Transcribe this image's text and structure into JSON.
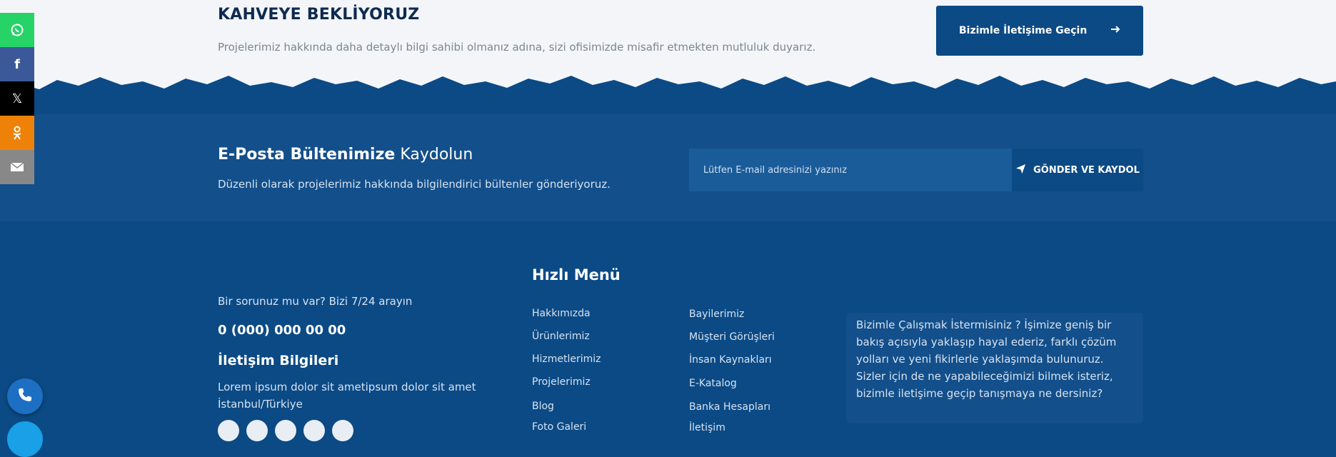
{
  "cta": {
    "title": "KAHVEYE BEKLİYORUZ",
    "description": "Projelerimiz hakkında daha detaylı bilgi sahibi olmanız adına, sizi ofisimizde misafir etmekten mutluluk duyarız.",
    "button_label": "Bizimle İletişime Geçin"
  },
  "newsletter": {
    "title_bold": "E-Posta Bültenimize",
    "title_regular": "Kaydolun",
    "description": "Düzenli olarak projelerimiz hakkında bilgilendirici bültenler gönderiyoruz.",
    "input_placeholder": "Lütfen E-mail adresinizi yazınız",
    "button_label": "GÖNDER VE KAYDOL"
  },
  "footer": {
    "help_text": "Bir sorunuz mu var? Bizi 7/24 arayın",
    "phone": "0 (000) 000 00 00",
    "contact_title": "İletişim Bilgileri",
    "address_line1": "Lorem ipsum dolor sit ametipsum dolor sit amet",
    "address_line2": "İstanbul/Türkiye",
    "quick_menu_title": "Hızlı Menü",
    "menu_col1": [
      "Hakkımızda",
      "Ürünlerimiz",
      "Hizmetlerimiz",
      "Projelerimiz",
      "Blog",
      "Foto Galeri"
    ],
    "menu_col2": [
      "Bayilerimiz",
      "Müşteri Görüşleri",
      "İnsan Kaynakları",
      "E-Katalog",
      "Banka Hesapları",
      "İletişim"
    ],
    "info_text": "Bizimle Çalışmak İstermisiniz ? İşimize geniş bir bakış açısıyla yaklaşıp hayal ederiz, farklı çözüm yolları ve yeni fikirlerle yaklaşımda bulunuruz. Sizler için de ne yapabileceğimizi bilmek isteriz, bizimle iletişime geçip tanışmaya ne dersiniz?"
  },
  "share_bar": {
    "items": [
      {
        "icon": "whatsapp-icon",
        "color": "#25d366"
      },
      {
        "icon": "facebook-icon",
        "color": "#3b5998"
      },
      {
        "icon": "x-icon",
        "color": "#000000"
      },
      {
        "icon": "odnoklassniki-icon",
        "color": "#ee8208"
      },
      {
        "icon": "email-icon",
        "color": "#888888"
      }
    ]
  },
  "colors": {
    "primary": "#0b4a85",
    "band": "#134f8a",
    "top_background": "#f3f5f9"
  }
}
